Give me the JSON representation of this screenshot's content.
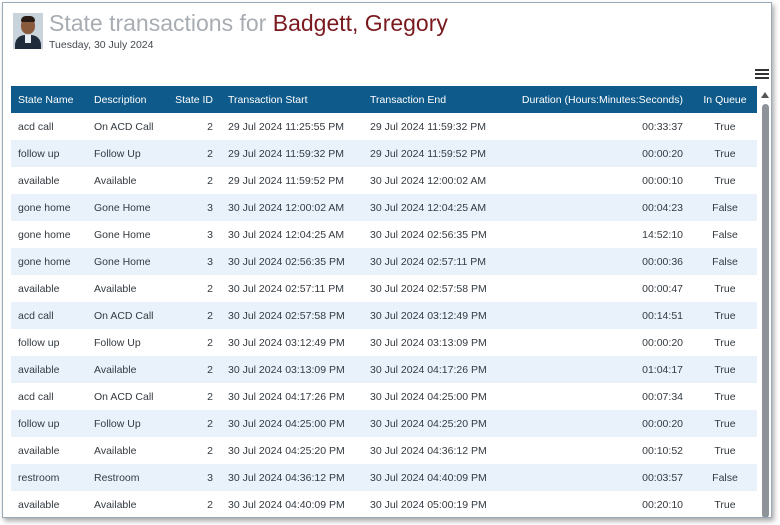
{
  "header": {
    "title_prefix": "State transactions for",
    "agent_name": "Badgett, Gregory",
    "date": "Tuesday, 30 July 2024"
  },
  "icons": {
    "menu": "hamburger-menu-icon",
    "scroll_up": "scroll-up-arrow-icon"
  },
  "colors": {
    "header_bg": "#0e5a8a",
    "row_alt": "#e9f2fb",
    "name_color": "#7a1a1f",
    "title_color": "#a7adb3"
  },
  "table": {
    "columns": [
      "State Name",
      "Description",
      "State ID",
      "Transaction Start",
      "Transaction End",
      "Duration (Hours:Minutes:Seconds)",
      "In Queue"
    ],
    "rows": [
      [
        "acd call",
        "On ACD Call",
        "2",
        "29 Jul 2024 11:25:55 PM",
        "29 Jul 2024 11:59:32 PM",
        "00:33:37",
        "True"
      ],
      [
        "follow up",
        "Follow Up",
        "2",
        "29 Jul 2024 11:59:32 PM",
        "29 Jul 2024 11:59:52 PM",
        "00:00:20",
        "True"
      ],
      [
        "available",
        "Available",
        "2",
        "29 Jul 2024 11:59:52 PM",
        "30 Jul 2024 12:00:02 AM",
        "00:00:10",
        "True"
      ],
      [
        "gone home",
        "Gone Home",
        "3",
        "30 Jul 2024 12:00:02 AM",
        "30 Jul 2024 12:04:25 AM",
        "00:04:23",
        "False"
      ],
      [
        "gone home",
        "Gone Home",
        "3",
        "30 Jul 2024 12:04:25 AM",
        "30 Jul 2024 02:56:35 PM",
        "14:52:10",
        "False"
      ],
      [
        "gone home",
        "Gone Home",
        "3",
        "30 Jul 2024 02:56:35 PM",
        "30 Jul 2024 02:57:11 PM",
        "00:00:36",
        "False"
      ],
      [
        "available",
        "Available",
        "2",
        "30 Jul 2024 02:57:11 PM",
        "30 Jul 2024 02:57:58 PM",
        "00:00:47",
        "True"
      ],
      [
        "acd call",
        "On ACD Call",
        "2",
        "30 Jul 2024 02:57:58 PM",
        "30 Jul 2024 03:12:49 PM",
        "00:14:51",
        "True"
      ],
      [
        "follow up",
        "Follow Up",
        "2",
        "30 Jul 2024 03:12:49 PM",
        "30 Jul 2024 03:13:09 PM",
        "00:00:20",
        "True"
      ],
      [
        "available",
        "Available",
        "2",
        "30 Jul 2024 03:13:09 PM",
        "30 Jul 2024 04:17:26 PM",
        "01:04:17",
        "True"
      ],
      [
        "acd call",
        "On ACD Call",
        "2",
        "30 Jul 2024 04:17:26 PM",
        "30 Jul 2024 04:25:00 PM",
        "00:07:34",
        "True"
      ],
      [
        "follow up",
        "Follow Up",
        "2",
        "30 Jul 2024 04:25:00 PM",
        "30 Jul 2024 04:25:20 PM",
        "00:00:20",
        "True"
      ],
      [
        "available",
        "Available",
        "2",
        "30 Jul 2024 04:25:20 PM",
        "30 Jul 2024 04:36:12 PM",
        "00:10:52",
        "True"
      ],
      [
        "restroom",
        "Restroom",
        "3",
        "30 Jul 2024 04:36:12 PM",
        "30 Jul 2024 04:40:09 PM",
        "00:03:57",
        "False"
      ],
      [
        "available",
        "Available",
        "2",
        "30 Jul 2024 04:40:09 PM",
        "30 Jul 2024 05:00:19 PM",
        "00:20:10",
        "True"
      ]
    ]
  }
}
